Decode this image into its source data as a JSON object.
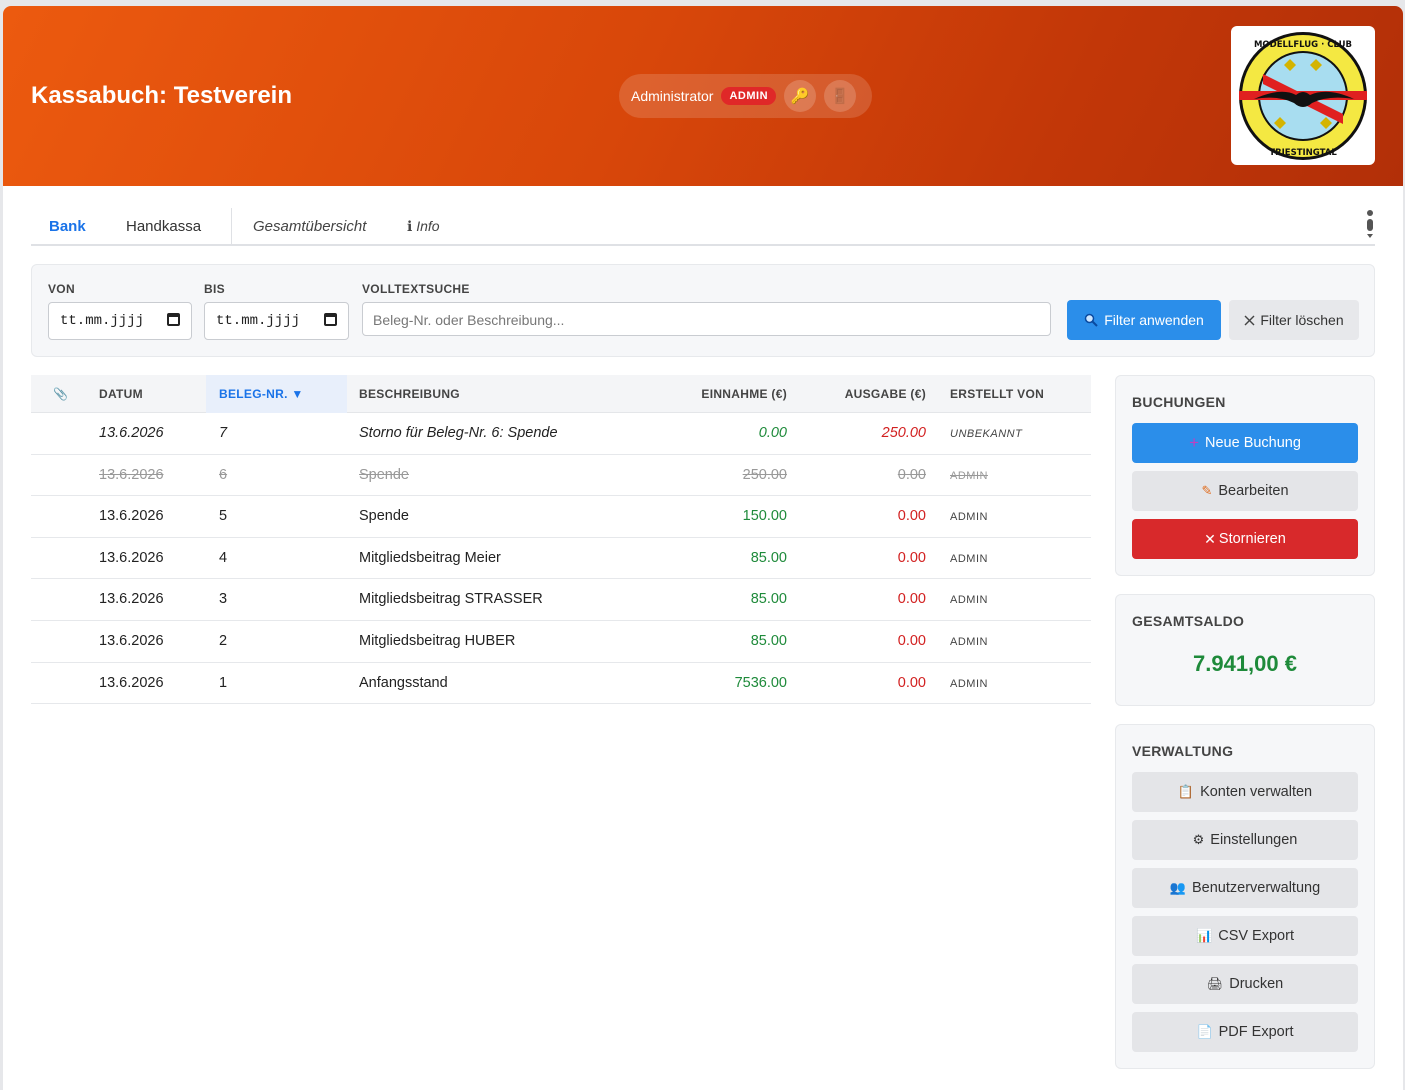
{
  "header": {
    "title": "Kassabuch: Testverein",
    "user_name": "Administrator",
    "role_badge": "ADMIN",
    "key_icon": "🔑",
    "door_icon": "🚪",
    "logo_alt": "MODELLFLUG - CLUB TRIESTINGTAL"
  },
  "tabs": [
    {
      "label": "Bank",
      "active": true
    },
    {
      "label": "Handkassa",
      "active": false
    },
    {
      "label": "Gesamtübersicht",
      "active": false
    },
    {
      "label": "ℹ Info",
      "active": false
    }
  ],
  "filter": {
    "von_label": "VON",
    "bis_label": "BIS",
    "search_label": "VOLLTEXTSUCHE",
    "date_placeholder": "tt.mm.jjjj",
    "search_placeholder": "Beleg-Nr. oder Beschreibung...",
    "apply_label": "Filter anwenden",
    "clear_label": "Filter löschen"
  },
  "table": {
    "columns": [
      "📎",
      "DATUM",
      "BELEG-NR. ▼",
      "BESCHREIBUNG",
      "EINNAHME (€)",
      "AUSGABE (€)",
      "ERSTELLT VON"
    ],
    "rows": [
      {
        "datum": "13.6.2026",
        "beleg": "7",
        "beschreibung": "Storno für Beleg-Nr. 6: Spende",
        "einnahme": "0.00",
        "ausgabe": "250.00",
        "von": "UNBEKANNT",
        "style": "italic"
      },
      {
        "datum": "13.6.2026",
        "beleg": "6",
        "beschreibung": "Spende",
        "einnahme": "250.00",
        "ausgabe": "0.00",
        "von": "ADMIN",
        "style": "strike"
      },
      {
        "datum": "13.6.2026",
        "beleg": "5",
        "beschreibung": "Spende",
        "einnahme": "150.00",
        "ausgabe": "0.00",
        "von": "ADMIN",
        "style": ""
      },
      {
        "datum": "13.6.2026",
        "beleg": "4",
        "beschreibung": "Mitgliedsbeitrag Meier",
        "einnahme": "85.00",
        "ausgabe": "0.00",
        "von": "ADMIN",
        "style": ""
      },
      {
        "datum": "13.6.2026",
        "beleg": "3",
        "beschreibung": "Mitgliedsbeitrag STRASSER",
        "einnahme": "85.00",
        "ausgabe": "0.00",
        "von": "ADMIN",
        "style": ""
      },
      {
        "datum": "13.6.2026",
        "beleg": "2",
        "beschreibung": "Mitgliedsbeitrag HUBER",
        "einnahme": "85.00",
        "ausgabe": "0.00",
        "von": "ADMIN",
        "style": ""
      },
      {
        "datum": "13.6.2026",
        "beleg": "1",
        "beschreibung": "Anfangsstand",
        "einnahme": "7536.00",
        "ausgabe": "0.00",
        "von": "ADMIN",
        "style": ""
      }
    ]
  },
  "buchungen": {
    "title": "BUCHUNGEN",
    "new_label": "Neue Buchung",
    "edit_label": "Bearbeiten",
    "storno_label": "Stornieren"
  },
  "gesamtsaldo": {
    "title": "GESAMTSALDO",
    "value": "7.941,00 €"
  },
  "verwaltung": {
    "title": "VERWALTUNG",
    "items": [
      {
        "icon": "📋",
        "label": "Konten verwalten"
      },
      {
        "icon": "⚙",
        "label": "Einstellungen"
      },
      {
        "icon": "👥",
        "label": "Benutzerverwaltung"
      },
      {
        "icon": "📊",
        "label": "CSV Export"
      },
      {
        "icon": "🖨",
        "label": "Drucken"
      },
      {
        "icon": "📄",
        "label": "PDF Export"
      }
    ]
  },
  "colors": {
    "header_start": "#ec5a0f",
    "header_end": "#b22f08",
    "accent_blue": "#2b8eea",
    "danger_red": "#d8292b",
    "income_green": "#1e8a3a"
  }
}
